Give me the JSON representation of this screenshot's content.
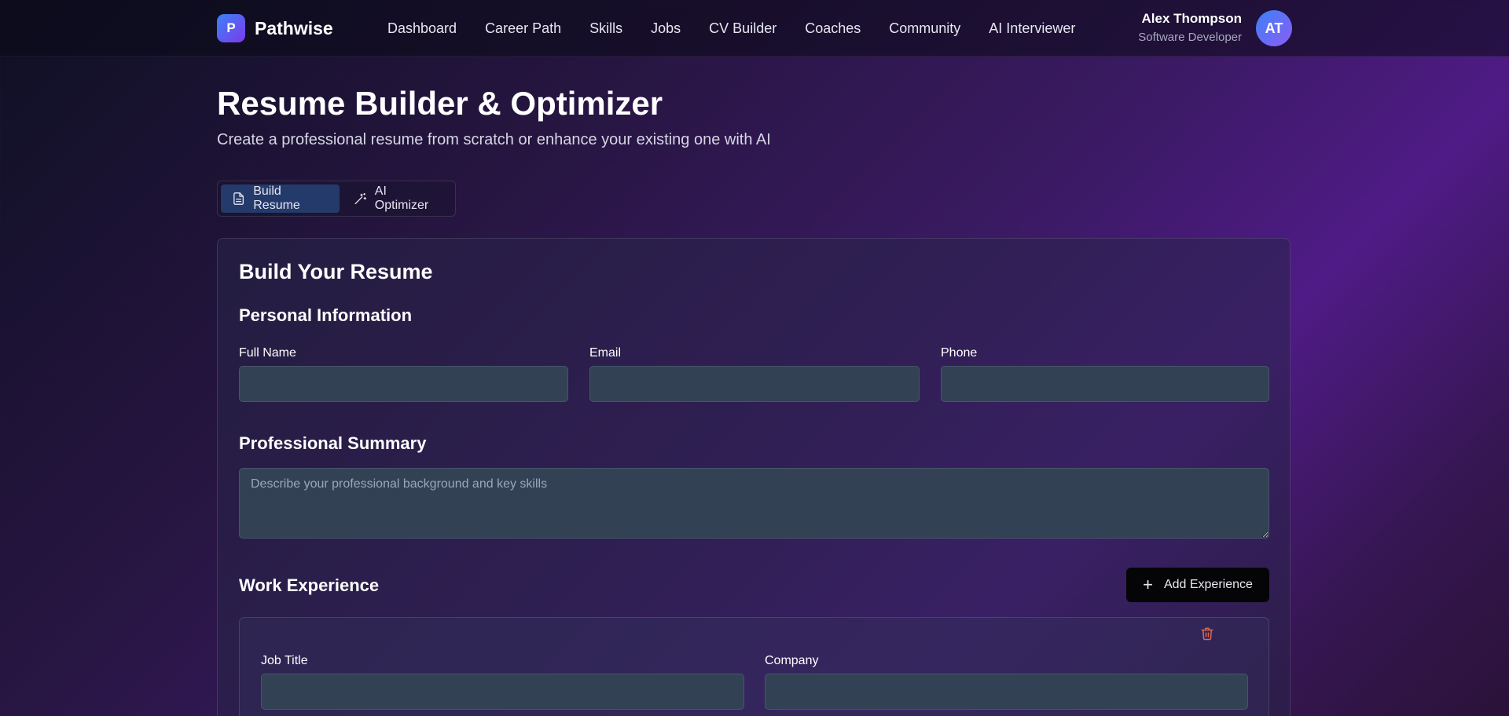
{
  "nav": {
    "brand_mark": "P",
    "brand_name": "Pathwise",
    "links": [
      "Dashboard",
      "Career Path",
      "Skills",
      "Jobs",
      "CV Builder",
      "Coaches",
      "Community",
      "AI Interviewer"
    ],
    "user": {
      "name": "Alex Thompson",
      "role": "Software Developer",
      "initials": "AT"
    }
  },
  "header": {
    "title": "Resume Builder & Optimizer",
    "subtitle": "Create a professional resume from scratch or enhance your existing one with AI"
  },
  "tabs": [
    {
      "label": "Build Resume",
      "icon": "document-icon",
      "active": true
    },
    {
      "label": "AI Optimizer",
      "icon": "magic-wand-icon",
      "active": false
    }
  ],
  "form": {
    "title": "Build Your Resume",
    "personal": {
      "heading": "Personal Information",
      "full_name_label": "Full Name",
      "full_name_value": "",
      "email_label": "Email",
      "email_value": "",
      "phone_label": "Phone",
      "phone_value": ""
    },
    "summary": {
      "heading": "Professional Summary",
      "placeholder": "Describe your professional background and key skills",
      "value": ""
    },
    "experience": {
      "heading": "Work Experience",
      "add_label": "Add Experience",
      "add_icon": "plus-icon",
      "delete_icon": "trash-icon",
      "job_title_label": "Job Title",
      "job_title_value": "",
      "company_label": "Company",
      "company_value": ""
    }
  },
  "colors": {
    "accent": "#243a6a",
    "input_bg": "#334155",
    "delete": "#e0674f"
  }
}
